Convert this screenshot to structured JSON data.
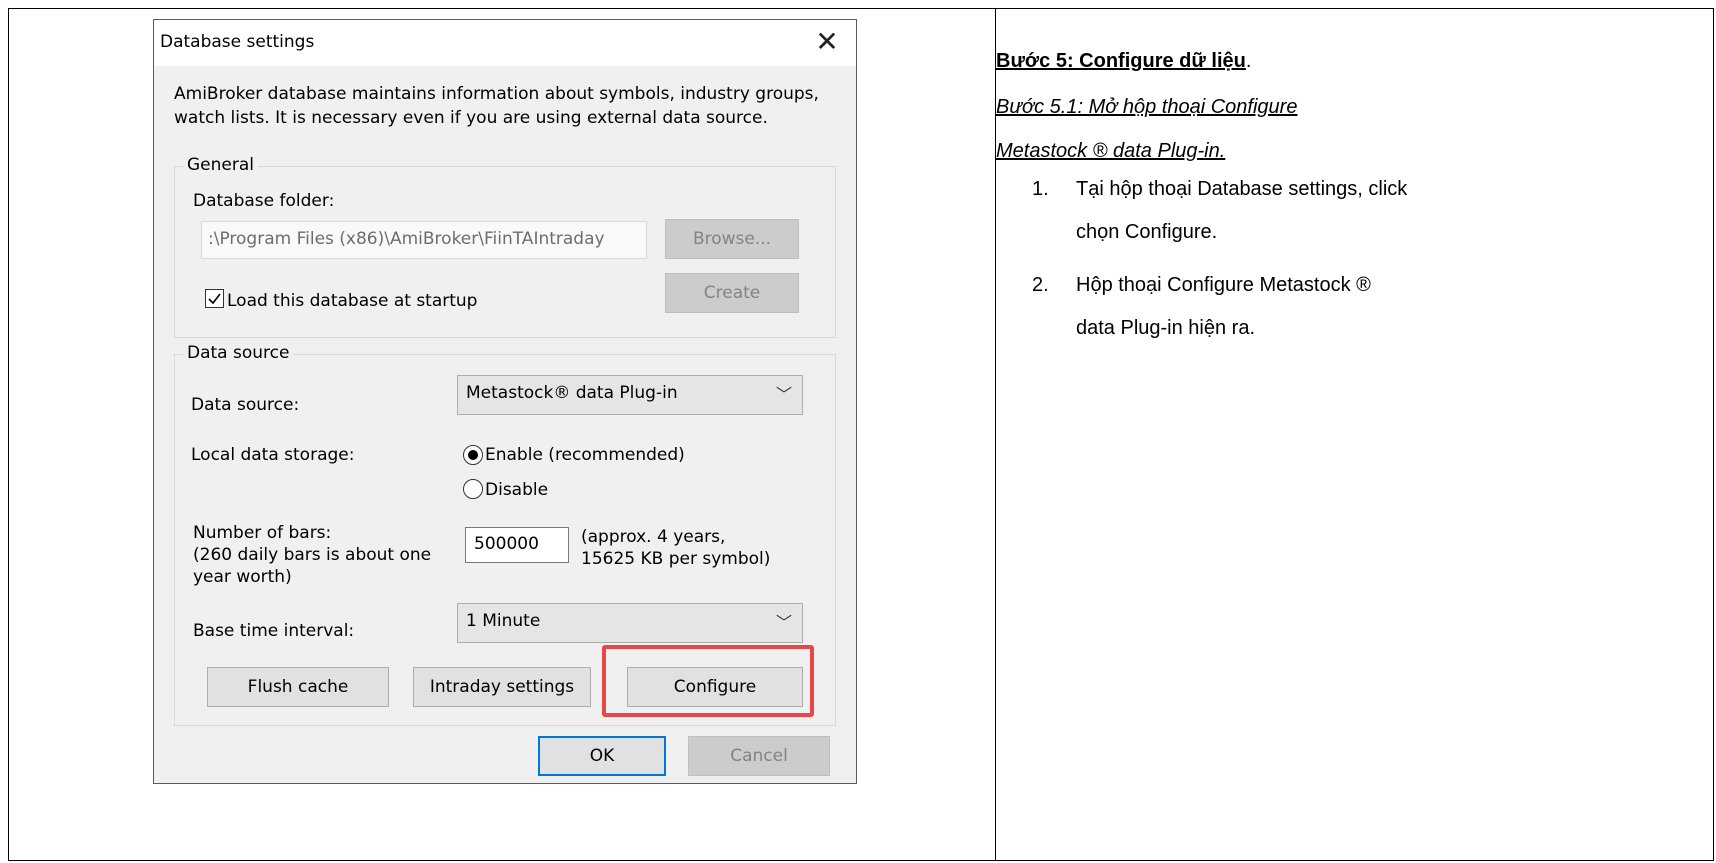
{
  "dialog": {
    "title": "Database settings",
    "close_glyph": "✕",
    "intro_line1": "AmiBroker database maintains information about symbols, industry groups,",
    "intro_line2": "watch lists. It is necessary even if you are using external data source.",
    "general": {
      "legend": "General",
      "folder_label": "Database folder:",
      "folder_value": ":\\Program Files (x86)\\AmiBroker\\FiinTAIntraday",
      "browse_label": "Browse...",
      "create_label": "Create",
      "load_at_startup_label": "Load this database at startup",
      "load_at_startup_checked": true
    },
    "data_source": {
      "legend": "Data source",
      "source_label": "Data source:",
      "source_value": "Metastock® data Plug-in",
      "local_storage_label": "Local data storage:",
      "enable_label": "Enable (recommended)",
      "disable_label": "Disable",
      "selected": "enable",
      "bars_label_1": "Number of bars:",
      "bars_label_2": "(260 daily bars is about one",
      "bars_label_3": "year worth)",
      "bars_value": "500000",
      "bars_note_1": "(approx. 4 years,",
      "bars_note_2": "15625 KB per symbol)",
      "interval_label": "Base time interval:",
      "interval_value": "1 Minute",
      "flush_label": "Flush cache",
      "intraday_label": "Intraday settings",
      "configure_label": "Configure"
    },
    "ok_label": "OK",
    "cancel_label": "Cancel"
  },
  "instructions": {
    "heading_bold": "Bước 5: Configure dữ liệu",
    "heading_suffix": ".",
    "sub_heading_1": "Bước 5.1: Mở hộp thoại Configure",
    "sub_heading_2": "Metastock ® data Plug-in.",
    "items": [
      {
        "num": "1.",
        "line1": "Tại hộp thoại Database settings, click",
        "line2": "chọn Configure."
      },
      {
        "num": "2.",
        "line1": "Hộp thoại Configure Metastock ®",
        "line2": "data Plug-in hiện ra."
      }
    ]
  },
  "colors": {
    "highlight": "#e8474a",
    "default_button_border": "#0078d7",
    "dialog_bg": "#f0f0f0"
  },
  "icons": {
    "close": "close-icon",
    "check": "check-icon",
    "dropdown": "chevron-down-icon"
  }
}
